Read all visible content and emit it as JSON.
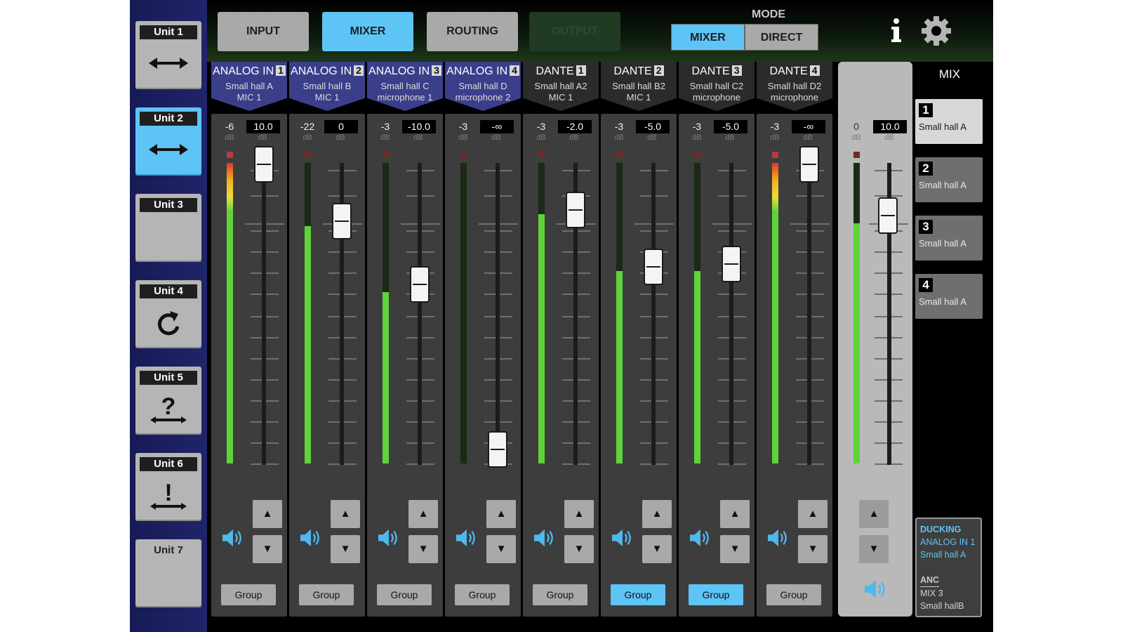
{
  "units": [
    {
      "label": "Unit 1",
      "icon": "bidirectional-arrow-icon",
      "active": false,
      "leds": true
    },
    {
      "label": "Unit 2",
      "icon": "bidirectional-arrow-icon",
      "active": true,
      "leds": true
    },
    {
      "label": "Unit 3",
      "icon": "",
      "active": false,
      "leds": true
    },
    {
      "label": "Unit 4",
      "icon": "refresh-icon",
      "active": false,
      "leds": true
    },
    {
      "label": "Unit 5",
      "icon": "question-arrow-icon",
      "active": false,
      "leds": true
    },
    {
      "label": "Unit 6",
      "icon": "exclamation-arrow-icon",
      "active": false,
      "leds": true
    },
    {
      "label": "Unit 7",
      "icon": "",
      "active": false,
      "leds": false
    }
  ],
  "tabs": [
    {
      "label": "INPUT",
      "state": "normal"
    },
    {
      "label": "MIXER",
      "state": "active"
    },
    {
      "label": "ROUTING",
      "state": "normal"
    },
    {
      "label": "OUTPUT",
      "state": "disabled"
    }
  ],
  "mode": {
    "label": "MODE",
    "options": [
      "MIXER",
      "DIRECT"
    ],
    "selected": "MIXER"
  },
  "icons": {
    "info": "info-icon",
    "settings": "gear-icon",
    "speaker": "speaker-icon"
  },
  "colors": {
    "accent": "#5ec4f6",
    "analog_header": "#3b3e8a",
    "meter_green": "#5fd33b"
  },
  "db_unit": "dB",
  "up_glyph": "▲",
  "down_glyph": "▼",
  "group_label": "Group",
  "channels": [
    {
      "type": "ANALOG IN",
      "num": "1",
      "name1": "Small hall A",
      "name2": "MIC 1",
      "kind": "analog",
      "meter_value": "-6",
      "gain": "10.0",
      "meter_level": 1.0,
      "clip": true,
      "fader": 1.0,
      "group_on": false
    },
    {
      "type": "ANALOG IN",
      "num": "2",
      "name1": "Small hall B",
      "name2": "MIC 1",
      "kind": "analog",
      "meter_value": "-22",
      "gain": "0",
      "meter_level": 0.79,
      "clip": false,
      "fader": 0.8,
      "group_on": false
    },
    {
      "type": "ANALOG IN",
      "num": "3",
      "name1": "Small hall C",
      "name2": "microphone 1",
      "kind": "analog",
      "meter_value": "-3",
      "gain": "-10.0",
      "meter_level": 0.57,
      "clip": false,
      "fader": 0.58,
      "group_on": false
    },
    {
      "type": "ANALOG IN",
      "num": "4",
      "name1": "Small hall D",
      "name2": "microphone 2",
      "kind": "analog",
      "meter_value": "-3",
      "gain": "-∞",
      "meter_level": 0.0,
      "clip": false,
      "fader": 0.0,
      "group_on": false
    },
    {
      "type": "DANTE",
      "num": "1",
      "name1": "Small hall A2",
      "name2": "MIC 1",
      "kind": "dante",
      "meter_value": "-3",
      "gain": "-2.0",
      "meter_level": 0.83,
      "clip": false,
      "fader": 0.84,
      "group_on": false
    },
    {
      "type": "DANTE",
      "num": "2",
      "name1": "Small hall B2",
      "name2": "MIC 1",
      "kind": "dante",
      "meter_value": "-3",
      "gain": "-5.0",
      "meter_level": 0.64,
      "clip": false,
      "fader": 0.64,
      "group_on": true
    },
    {
      "type": "DANTE",
      "num": "3",
      "name1": "Small hall C2",
      "name2": "microphone",
      "kind": "dante",
      "meter_value": "-3",
      "gain": "-5.0",
      "meter_level": 0.64,
      "clip": false,
      "fader": 0.65,
      "group_on": true
    },
    {
      "type": "DANTE",
      "num": "4",
      "name1": "Small hall D2",
      "name2": "microphone",
      "kind": "dante",
      "meter_value": "-3",
      "gain": "-∞",
      "meter_level": 1.0,
      "clip": true,
      "fader": 1.0,
      "group_on": false
    }
  ],
  "master": {
    "meter_value": "0",
    "gain": "10.0",
    "meter_level": 0.8,
    "fader": 0.8
  },
  "mix": {
    "label": "MIX",
    "items": [
      {
        "num": "1",
        "name": "Small hall A",
        "active": true
      },
      {
        "num": "2",
        "name": "Small hall A",
        "active": false
      },
      {
        "num": "3",
        "name": "Small hall A",
        "active": false
      },
      {
        "num": "4",
        "name": "Small hall A",
        "active": false
      }
    ]
  },
  "info_box": {
    "ducking_label": "DUCKING",
    "ducking_source": "ANALOG IN 1",
    "ducking_target": "Small hall A",
    "anc_label": "ANC",
    "anc_source": "MIX 3",
    "anc_target": "Small hallB"
  }
}
